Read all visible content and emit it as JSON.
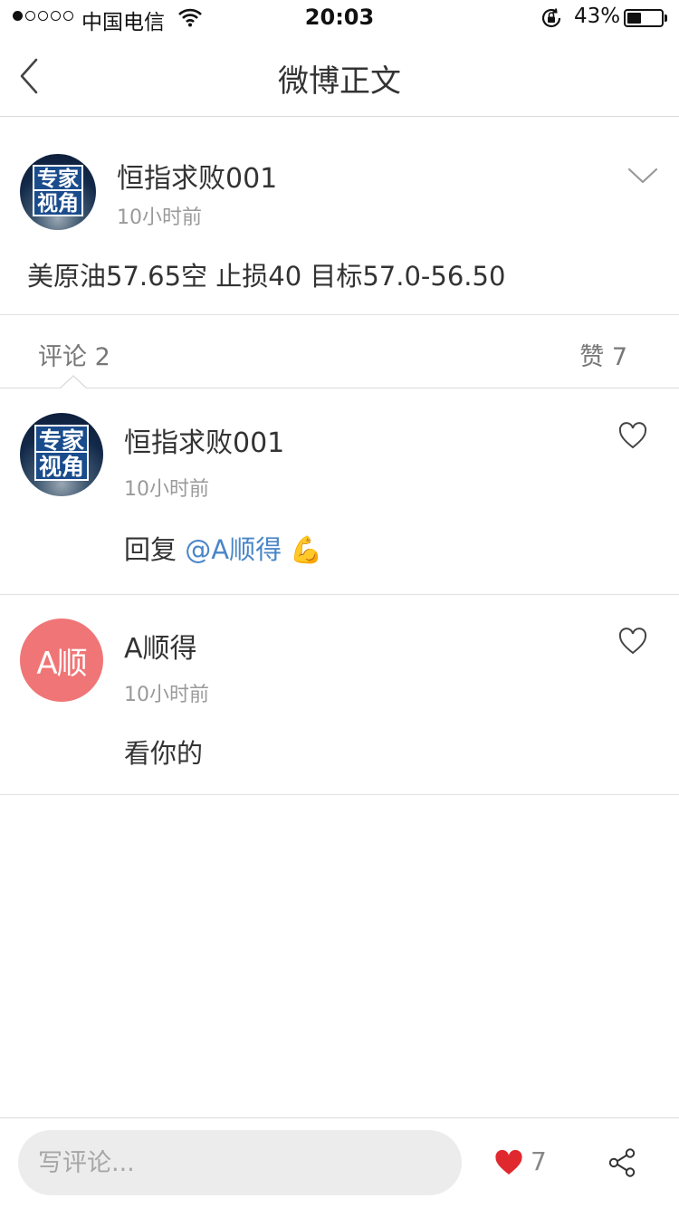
{
  "status_bar": {
    "carrier": "中国电信",
    "time": "20:03",
    "battery_percent": "43%",
    "battery_level": 0.43,
    "signal_bars_filled": 1,
    "signal_bars_total": 5
  },
  "nav": {
    "title": "微博正文"
  },
  "post": {
    "author": "恒指求败001",
    "avatar_lines": [
      "专家",
      "视角"
    ],
    "time": "10小时前",
    "text": "美原油57.65空 止损40   目标57.0-56.50"
  },
  "tabs": {
    "comments_label": "评论",
    "comments_count": "2",
    "likes_label": "赞",
    "likes_count": "7"
  },
  "comments": [
    {
      "author": "恒指求败001",
      "avatar_lines": [
        "专家",
        "视角"
      ],
      "time": "10小时前",
      "reply_prefix": "回复",
      "mention": "@A顺得",
      "emoji": "💪",
      "icon": "heart-outline-icon"
    },
    {
      "author": "A顺得",
      "avatar_text": "A顺",
      "time": "10小时前",
      "text": "看你的",
      "icon": "heart-outline-icon"
    }
  ],
  "bottom_bar": {
    "comment_placeholder": "写评论...",
    "like_count": "7"
  },
  "colors": {
    "mention": "#4a86c8",
    "like_heart": "#e0292f",
    "avatar_a_bg": "#f07576"
  }
}
